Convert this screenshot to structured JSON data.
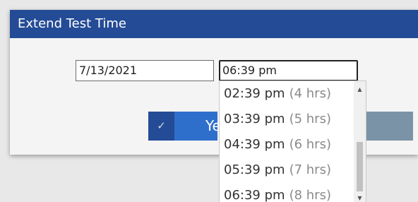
{
  "dialog": {
    "title": "Extend Test Time",
    "date_value": "7/13/2021",
    "time_value": "06:39 pm",
    "confirm_label": "Ye",
    "confirm_icon": "check-icon"
  },
  "dropdown": {
    "options": [
      {
        "time": "02:39 pm",
        "duration": "(4 hrs)"
      },
      {
        "time": "03:39 pm",
        "duration": "(5 hrs)"
      },
      {
        "time": "04:39 pm",
        "duration": "(6 hrs)"
      },
      {
        "time": "05:39 pm",
        "duration": "(7 hrs)"
      },
      {
        "time": "06:39 pm",
        "duration": "(8 hrs)"
      }
    ]
  },
  "colors": {
    "titlebar": "#244b96",
    "confirm": "#2f6fcc",
    "cancel": "#7b93a6"
  }
}
